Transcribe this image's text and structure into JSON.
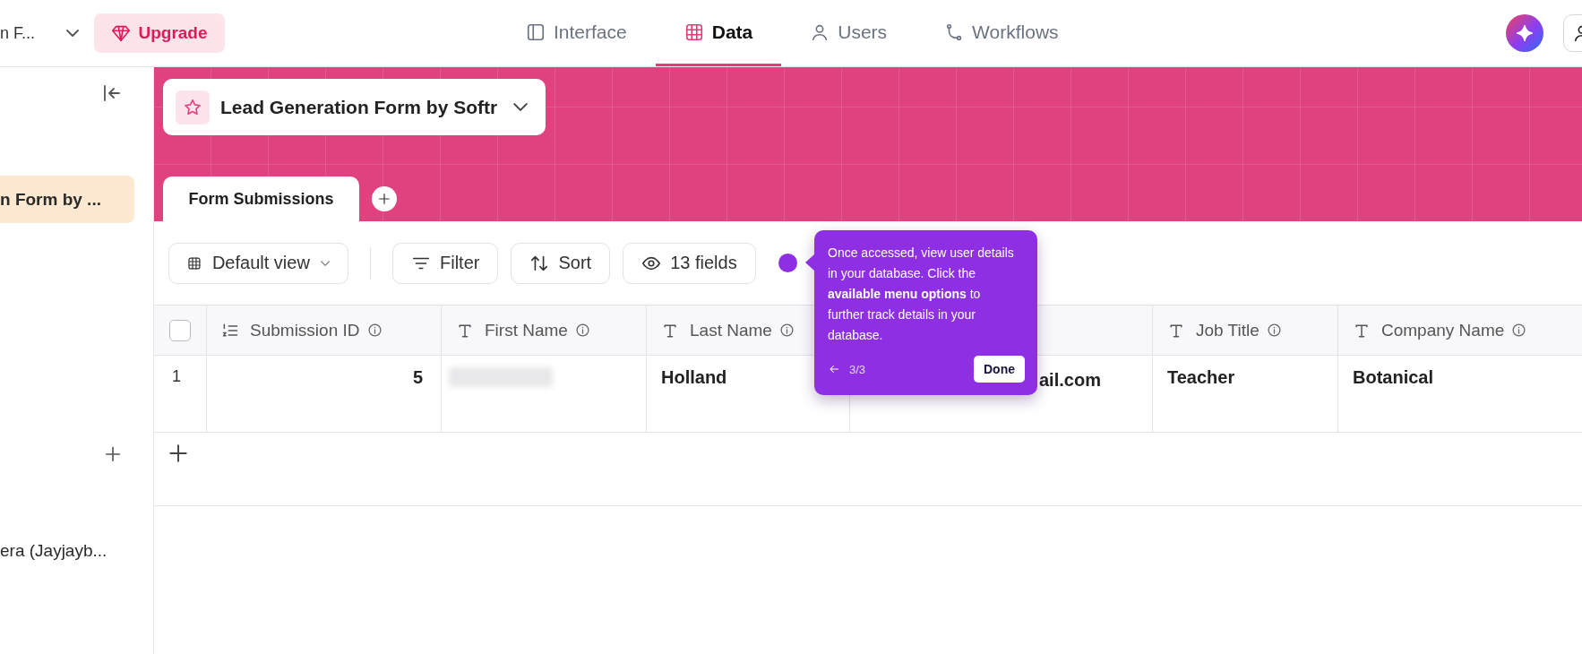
{
  "top_bar": {
    "workspace": "n F...",
    "upgrade": "Upgrade",
    "nav": [
      {
        "label": "Interface",
        "selected": false
      },
      {
        "label": "Data",
        "selected": true
      },
      {
        "label": "Users",
        "selected": false
      },
      {
        "label": "Workflows",
        "selected": false
      }
    ]
  },
  "sidebar": {
    "items": [
      {
        "label": "n Form by ...",
        "selected": true
      },
      {
        "label": "era (Jayjayb...",
        "selected": false
      }
    ]
  },
  "base_selector": {
    "title": "Lead Generation Form by Softr"
  },
  "tabs": [
    {
      "label": "Form Submissions",
      "selected": true
    }
  ],
  "toolbar": {
    "view": "Default view",
    "buttons": [
      {
        "label": "Filter"
      },
      {
        "label": "Sort"
      },
      {
        "label": "13 fields"
      }
    ]
  },
  "table": {
    "header_checkbox": {
      "checked": false
    },
    "columns": [
      {
        "label": "Submission ID",
        "kind": "number"
      },
      {
        "label": "First Name",
        "kind": "text"
      },
      {
        "label": "Last Name",
        "kind": "text"
      },
      {
        "kind": "covered"
      },
      {
        "label": "Job Title",
        "kind": "text"
      },
      {
        "label": "Company Name",
        "kind": "text"
      }
    ],
    "rows": [
      {
        "number": "1",
        "cells": [
          {
            "kind": "number",
            "value": "5"
          },
          {
            "kind": "blurred"
          },
          {
            "kind": "text",
            "value": "Holland"
          },
          {
            "kind": "covered",
            "value": "ail.com"
          },
          {
            "kind": "text",
            "value": "Teacher"
          },
          {
            "kind": "text",
            "value": "Botanical"
          }
        ]
      }
    ]
  },
  "tooltip": {
    "text": "Once accessed, view user details in your database. Click the **available menu options** to further track details in your database.",
    "step": "3/3",
    "done": "Done"
  }
}
